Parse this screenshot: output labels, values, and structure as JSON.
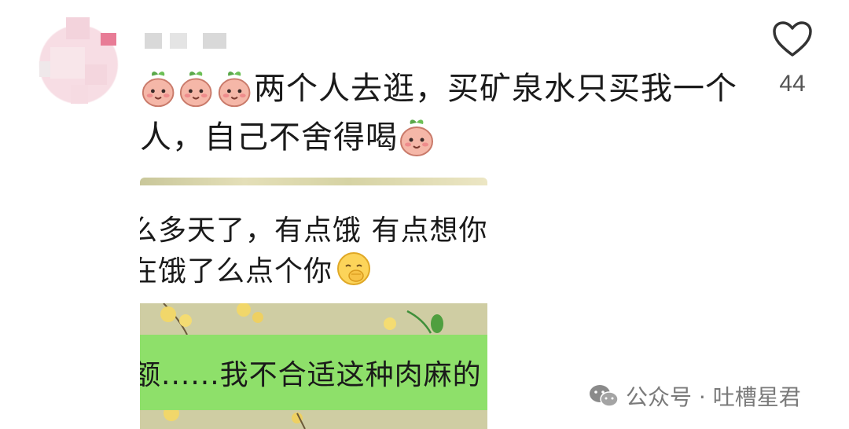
{
  "comment": {
    "line1_text": "两个人去逛，买矿泉水只买我一个",
    "line2_text": "人，自己不舍得喝",
    "emoji_icon": "peach-face-icon"
  },
  "like": {
    "count": "44",
    "icon": "heart-outline-icon"
  },
  "attached_image": {
    "message1": "么多天了，有点饿 有点想你",
    "message2": "在饿了么点个你",
    "message2_emoji": "shy-face-icon",
    "message3": "额......我不合适这种肉麻的"
  },
  "watermark": {
    "text": "公众号 · 吐槽星君",
    "icon": "wechat-icon"
  },
  "colors": {
    "bubble_green": "#8ee06a",
    "peach_pink": "#f3b0a4",
    "leaf_green": "#3f8f3a"
  }
}
